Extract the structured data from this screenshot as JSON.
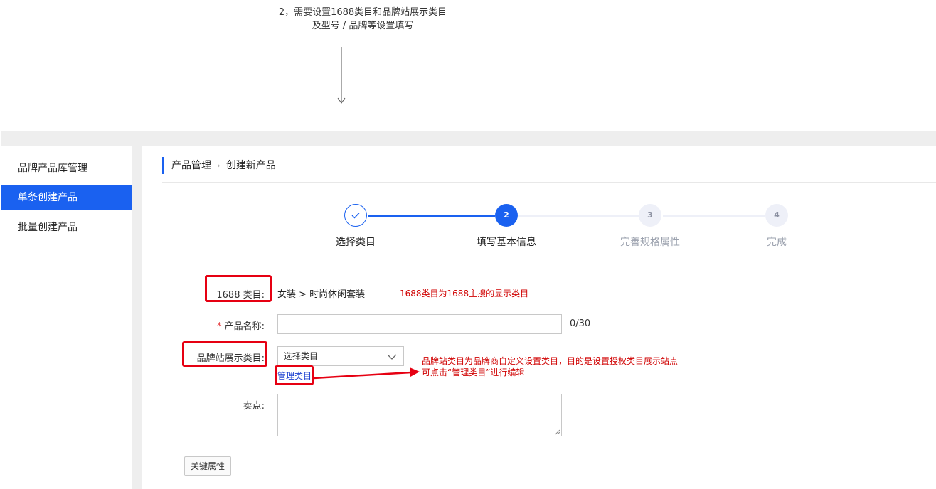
{
  "top_annotation": {
    "line1": "2，需要设置1688类目和品牌站展示类目",
    "line2": "及型号 / 品牌等设置填写"
  },
  "sidebar": {
    "items": [
      {
        "label": "品牌产品库管理",
        "active": false
      },
      {
        "label": "单条创建产品",
        "active": true
      },
      {
        "label": "批量创建产品",
        "active": false
      }
    ]
  },
  "breadcrumb": {
    "parent": "产品管理",
    "current": "创建新产品"
  },
  "steps": [
    {
      "label": "选择类目",
      "number": "✓",
      "state": "done"
    },
    {
      "label": "填写基本信息",
      "number": "2",
      "state": "active"
    },
    {
      "label": "完善规格属性",
      "number": "3",
      "state": "pending"
    },
    {
      "label": "完成",
      "number": "4",
      "state": "pending"
    }
  ],
  "form": {
    "category_label": "1688 类目:",
    "category_value": "女装 > 时尚休闲套装",
    "name_required_mark": "*",
    "name_label": "产品名称:",
    "name_value": "",
    "name_count": "0/30",
    "brand_category_label": "品牌站展示类目:",
    "brand_category_select": "选择类目",
    "manage_link": "管理类目",
    "selling_point_label": "卖点:",
    "selling_point_value": "",
    "key_attributes_button": "关键属性"
  },
  "annotations": {
    "category_note": "1688类目为1688主搜的显示类目",
    "brand_note_line1": "品牌站类目为品牌商自定义设置类目，目的是设置授权类目展示站点",
    "brand_note_line2": "可点击“管理类目”进行编辑"
  },
  "colors": {
    "primary": "#1a61f0",
    "annotation_red": "#e60012",
    "pending_step": "#eef0f8"
  }
}
